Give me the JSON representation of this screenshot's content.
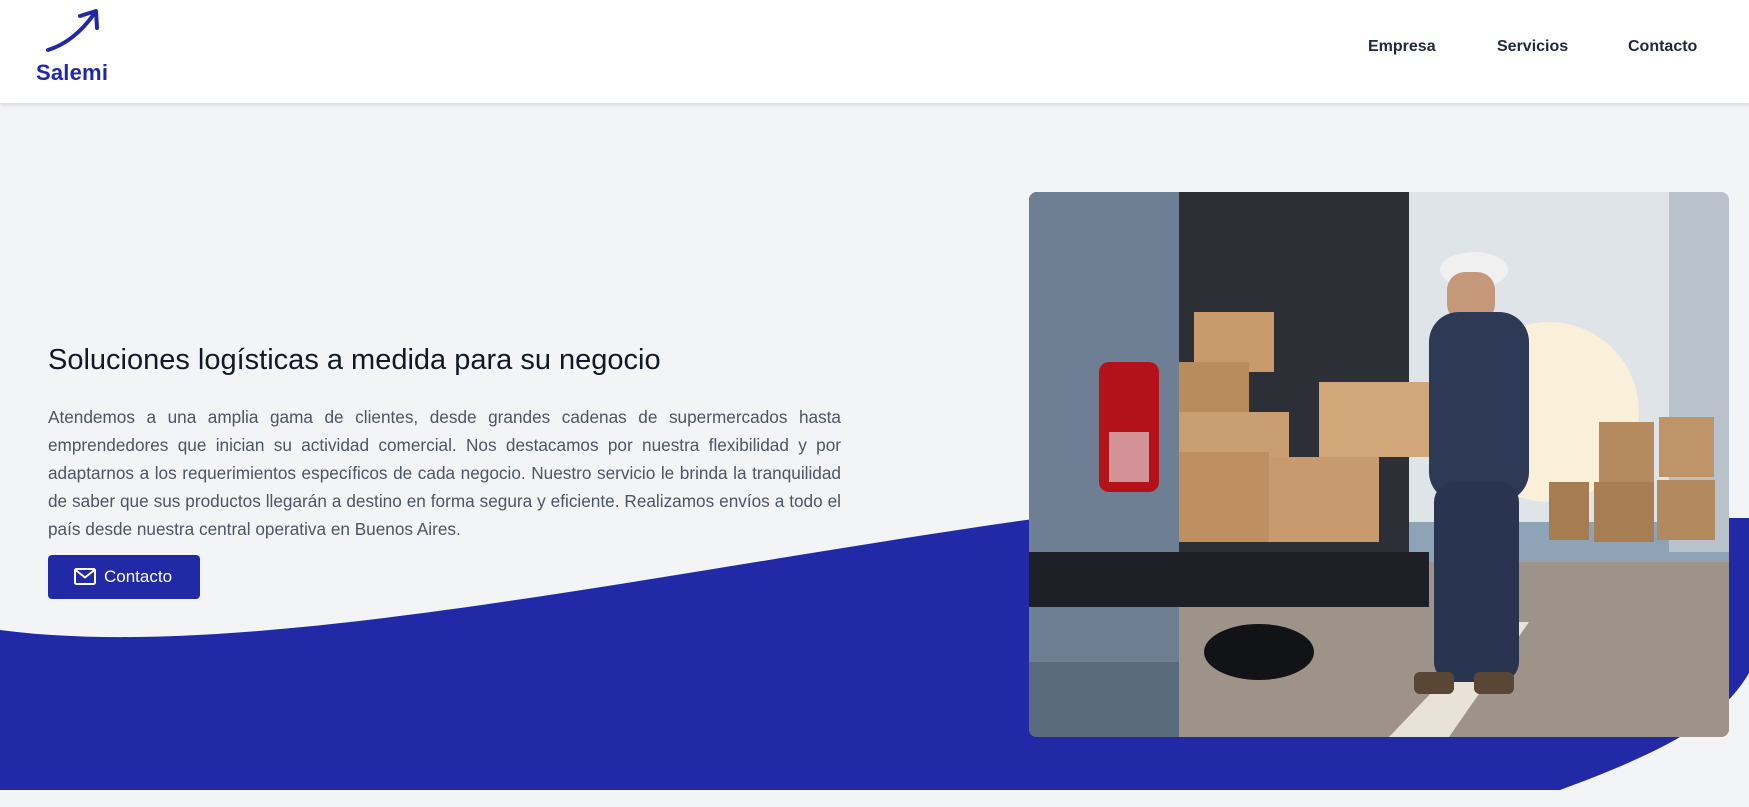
{
  "brand": {
    "name": "Salemi",
    "color": "#2128a8"
  },
  "nav": {
    "items": [
      {
        "label": "Empresa"
      },
      {
        "label": "Servicios"
      },
      {
        "label": "Contacto"
      }
    ]
  },
  "hero": {
    "title": "Soluciones logísticas a medida para su negocio",
    "body": "Atendemos a una amplia gama de clientes, desde grandes cadenas de supermercados hasta emprendedores que inician su actividad comercial. Nos destacamos por nuestra flexibilidad y por adaptarnos a los requerimientos específicos de cada negocio. Nuestro servicio le brinda la tranquilidad de saber que sus productos llegarán a destino en forma segura y eficiente. Realizamos envíos a todo el país desde nuestra central operativa en Buenos Aires.",
    "cta_label": "Contacto",
    "cta_icon": "mail-icon",
    "image_subject": "delivery-worker-loading-van-photo"
  },
  "colors": {
    "accent": "#2129a6",
    "background": "#f3f4f6",
    "header_bg": "#ffffff"
  }
}
